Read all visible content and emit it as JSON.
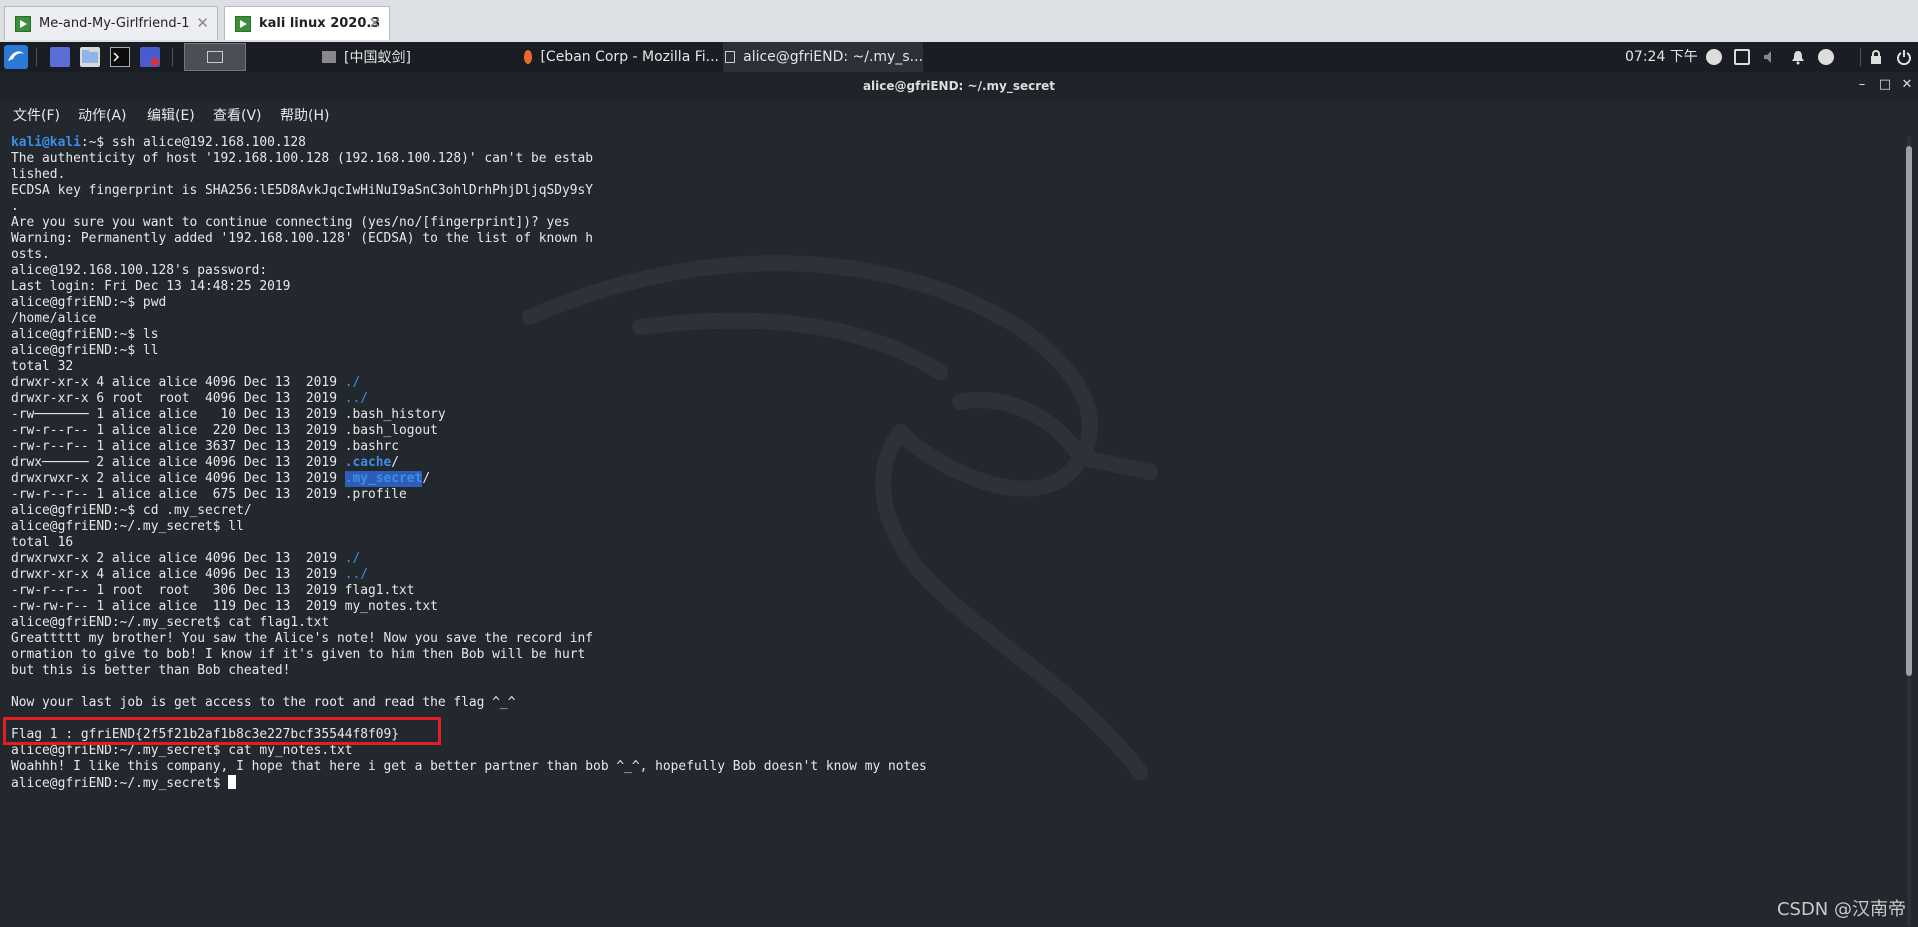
{
  "vm_tabs": [
    {
      "label": "Me-and-My-Girlfriend-1",
      "close": "✕"
    },
    {
      "label": "kali linux 2020.3",
      "close": "✕"
    }
  ],
  "panel": {
    "tasks": [
      {
        "label": "[中国蚁剑]",
        "icon": "window-icon"
      },
      {
        "label": "[Ceban Corp - Mozilla Fi...",
        "icon": "firefox-icon"
      },
      {
        "label": "alice@gfriEND: ~/.my_s...",
        "icon": "terminal-icon"
      }
    ],
    "clock": "07:24 下午"
  },
  "window": {
    "title": "alice@gfriEND: ~/.my_secret",
    "menus": [
      "文件(F)",
      "动作(A)",
      "编辑(E)",
      "查看(V)",
      "帮助(H)"
    ]
  },
  "terminal": {
    "lines": [
      {
        "segments": [
          {
            "t": "kali@kali",
            "c": "kali"
          },
          {
            "t": ":~$ ssh alice@192.168.100.128",
            "c": ""
          }
        ]
      },
      {
        "segments": [
          {
            "t": "The authenticity of host '192.168.100.128 (192.168.100.128)' can't be estab",
            "c": ""
          }
        ]
      },
      {
        "segments": [
          {
            "t": "lished.",
            "c": ""
          }
        ]
      },
      {
        "segments": [
          {
            "t": "ECDSA key fingerprint is SHA256:lE5D8AvkJqcIwHiNuI9aSnC3ohlDrhPhjDljqSDy9sY",
            "c": ""
          }
        ]
      },
      {
        "segments": [
          {
            "t": ".",
            "c": ""
          }
        ]
      },
      {
        "segments": [
          {
            "t": "Are you sure you want to continue connecting (yes/no/[fingerprint])? yes",
            "c": ""
          }
        ]
      },
      {
        "segments": [
          {
            "t": "Warning: Permanently added '192.168.100.128' (ECDSA) to the list of known h",
            "c": ""
          }
        ]
      },
      {
        "segments": [
          {
            "t": "osts.",
            "c": ""
          }
        ]
      },
      {
        "segments": [
          {
            "t": "alice@192.168.100.128's password:",
            "c": ""
          }
        ]
      },
      {
        "segments": [
          {
            "t": "Last login: Fri Dec 13 14:48:25 2019",
            "c": ""
          }
        ]
      },
      {
        "segments": [
          {
            "t": "alice@gfriEND:~$ pwd",
            "c": ""
          }
        ]
      },
      {
        "segments": [
          {
            "t": "/home/alice",
            "c": ""
          }
        ]
      },
      {
        "segments": [
          {
            "t": "alice@gfriEND:~$ ls",
            "c": ""
          }
        ]
      },
      {
        "segments": [
          {
            "t": "alice@gfriEND:~$ ll",
            "c": ""
          }
        ]
      },
      {
        "segments": [
          {
            "t": "total 32",
            "c": ""
          }
        ]
      },
      {
        "segments": [
          {
            "t": "drwxr-xr-x 4 alice alice 4096 Dec 13  2019 ",
            "c": ""
          },
          {
            "t": "./",
            "c": "blue"
          }
        ]
      },
      {
        "segments": [
          {
            "t": "drwxr-xr-x 6 root  root  4096 Dec 13  2019 ",
            "c": ""
          },
          {
            "t": "../",
            "c": "blue"
          }
        ]
      },
      {
        "segments": [
          {
            "t": "-rw─────── 1 alice alice   10 Dec 13  2019 .bash_history",
            "c": ""
          }
        ]
      },
      {
        "segments": [
          {
            "t": "-rw-r--r-- 1 alice alice  220 Dec 13  2019 .bash_logout",
            "c": ""
          }
        ]
      },
      {
        "segments": [
          {
            "t": "-rw-r--r-- 1 alice alice 3637 Dec 13  2019 .bashrc",
            "c": ""
          }
        ]
      },
      {
        "segments": [
          {
            "t": "drwx────── 2 alice alice 4096 Dec 13  2019 ",
            "c": ""
          },
          {
            "t": ".cache",
            "c": "bblue"
          },
          {
            "t": "/",
            "c": ""
          }
        ]
      },
      {
        "segments": [
          {
            "t": "drwxrwxr-x 2 alice alice 4096 Dec 13  2019 ",
            "c": ""
          },
          {
            "t": ".my_secret",
            "c": "hl"
          },
          {
            "t": "/",
            "c": ""
          }
        ]
      },
      {
        "segments": [
          {
            "t": "-rw-r--r-- 1 alice alice  675 Dec 13  2019 .profile",
            "c": ""
          }
        ]
      },
      {
        "segments": [
          {
            "t": "alice@gfriEND:~$ cd .my_secret/",
            "c": ""
          }
        ]
      },
      {
        "segments": [
          {
            "t": "alice@gfriEND:~/.my_secret$ ll",
            "c": ""
          }
        ]
      },
      {
        "segments": [
          {
            "t": "total 16",
            "c": ""
          }
        ]
      },
      {
        "segments": [
          {
            "t": "drwxrwxr-x 2 alice alice 4096 Dec 13  2019 ",
            "c": ""
          },
          {
            "t": "./",
            "c": "blue"
          }
        ]
      },
      {
        "segments": [
          {
            "t": "drwxr-xr-x 4 alice alice 4096 Dec 13  2019 ",
            "c": ""
          },
          {
            "t": "../",
            "c": "blue"
          }
        ]
      },
      {
        "segments": [
          {
            "t": "-rw-r--r-- 1 root  root   306 Dec 13  2019 flag1.txt",
            "c": ""
          }
        ]
      },
      {
        "segments": [
          {
            "t": "-rw-rw-r-- 1 alice alice  119 Dec 13  2019 my_notes.txt",
            "c": ""
          }
        ]
      },
      {
        "segments": [
          {
            "t": "alice@gfriEND:~/.my_secret$ cat flag1.txt",
            "c": ""
          }
        ]
      },
      {
        "segments": [
          {
            "t": "Greattttt my brother! You saw the Alice's note! Now you save the record inf",
            "c": ""
          }
        ]
      },
      {
        "segments": [
          {
            "t": "ormation to give to bob! I know if it's given to him then Bob will be hurt",
            "c": ""
          }
        ]
      },
      {
        "segments": [
          {
            "t": "but this is better than Bob cheated!",
            "c": ""
          }
        ]
      },
      {
        "segments": [
          {
            "t": "",
            "c": ""
          }
        ]
      },
      {
        "segments": [
          {
            "t": "Now your last job is get access to the root and read the flag ^_^",
            "c": ""
          }
        ]
      },
      {
        "segments": [
          {
            "t": "",
            "c": ""
          }
        ]
      },
      {
        "segments": [
          {
            "t": "Flag 1 : gfriEND{2f5f21b2af1b8c3e227bcf35544f8f09}",
            "c": ""
          }
        ]
      },
      {
        "segments": [
          {
            "t": "alice@gfriEND:~/.my_secret$ cat my_notes.txt",
            "c": ""
          }
        ]
      },
      {
        "segments": [
          {
            "t": "Woahhh! I like this company, I hope that here i get a better partner than bob ^_^, hopefully Bob doesn't know my notes",
            "c": ""
          }
        ]
      },
      {
        "segments": [
          {
            "t": "alice@gfriEND:~/.my_secret$ ",
            "c": ""
          },
          {
            "t": "",
            "c": "cursor"
          }
        ]
      }
    ]
  },
  "watermark": "CSDN @汉南帝",
  "colors": {
    "terminal_bg": "#23272e",
    "prompt_blue": "#3d8ee8",
    "highlight_box": "#e02020"
  }
}
